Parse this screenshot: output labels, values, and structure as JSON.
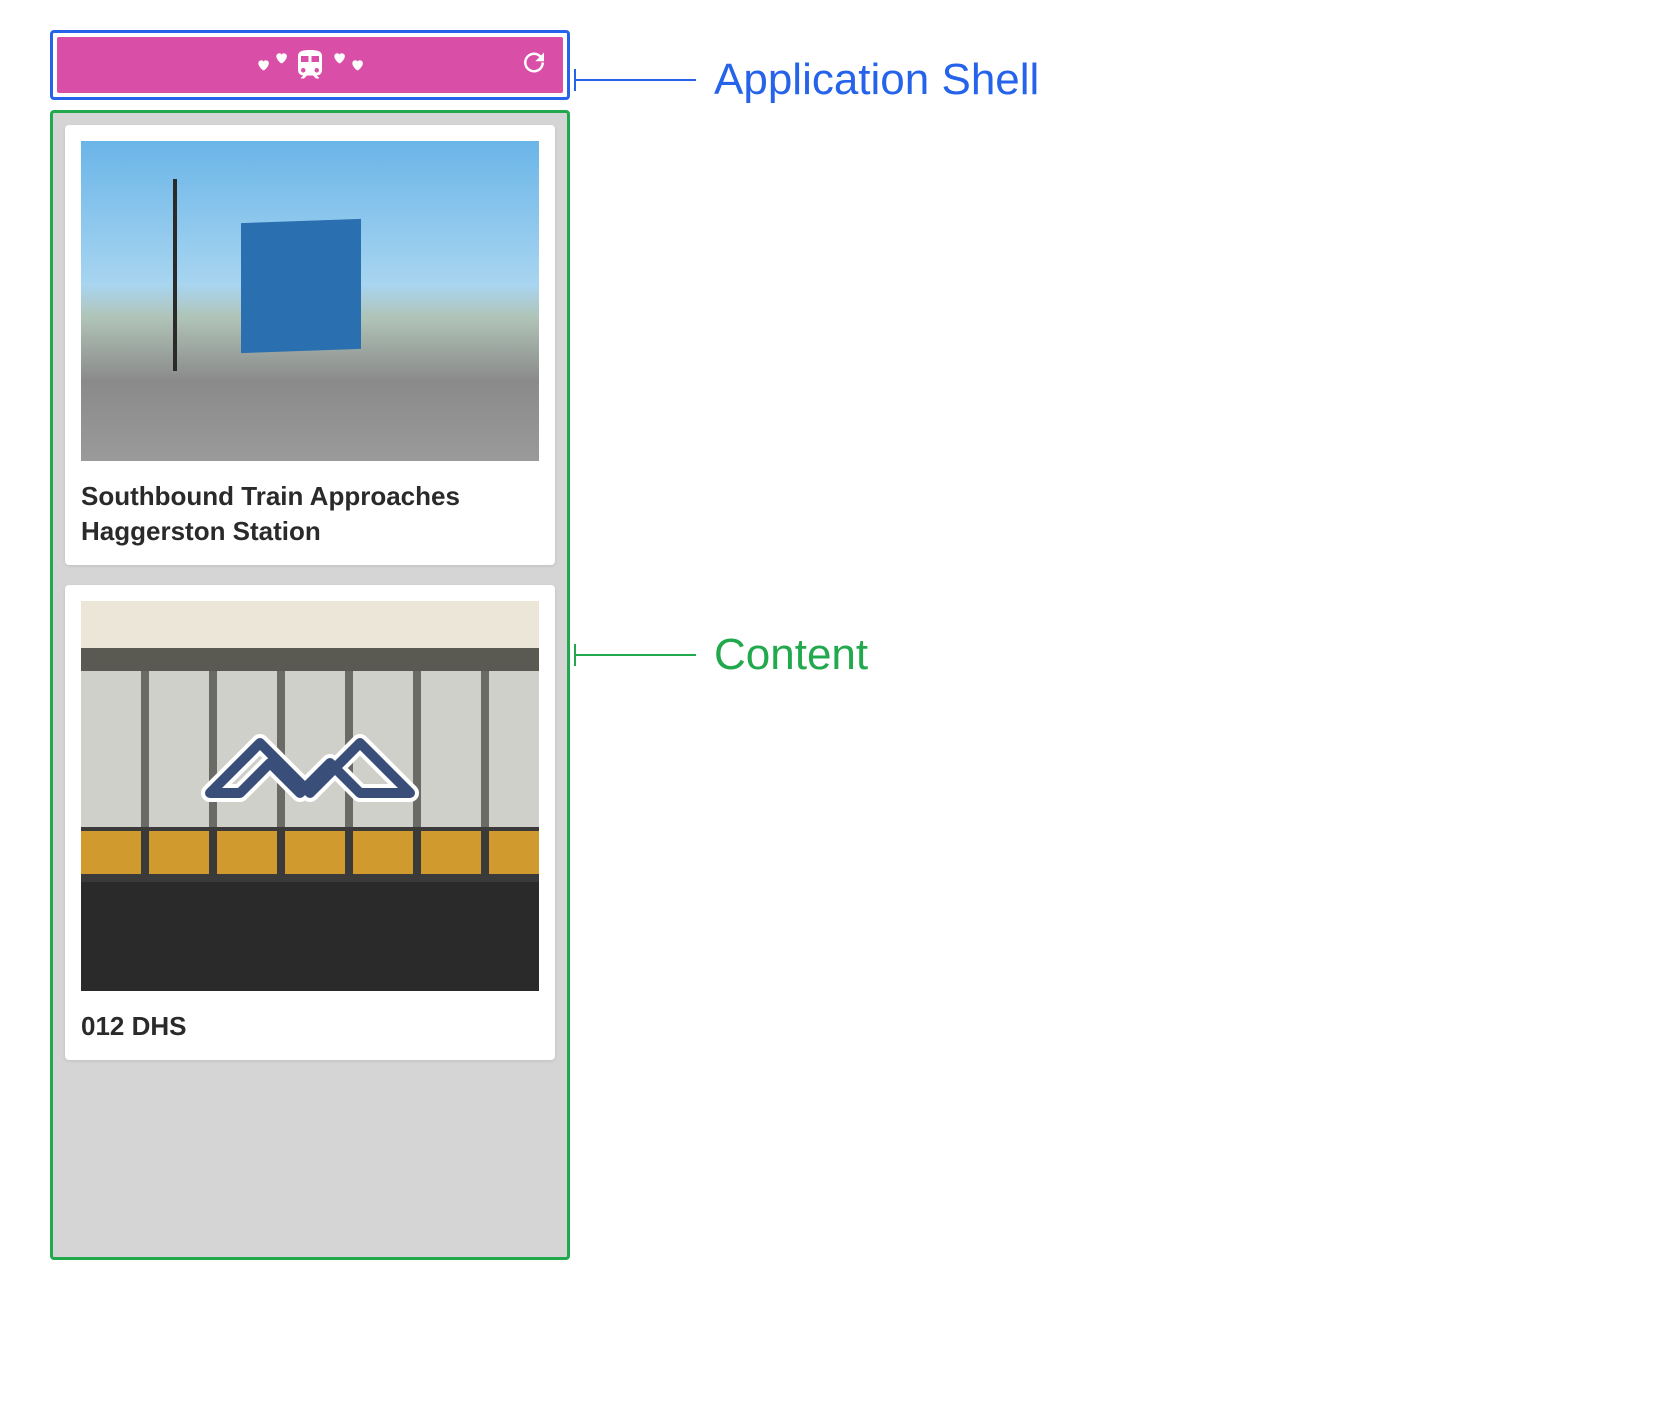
{
  "annotations": {
    "shell_label": "Application Shell",
    "content_label": "Content"
  },
  "colors": {
    "shell_outline": "#2563eb",
    "content_outline": "#22a94d",
    "header_bg": "#d94fa8"
  },
  "header": {
    "logo_name": "train-hearts-icon",
    "reload_name": "reload-icon"
  },
  "cards": [
    {
      "title": "Southbound Train Approaches Haggerston Station",
      "image_description": "Street scene with blue building mural, lamp post, train on bridge"
    },
    {
      "title": "012 DHS",
      "image_description": "Station facade with NS railway logo over windowed structure"
    }
  ]
}
